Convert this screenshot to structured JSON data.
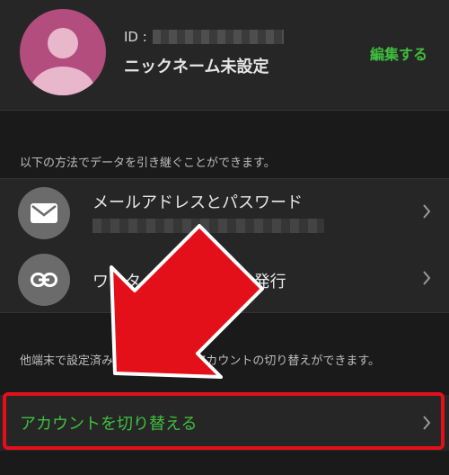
{
  "profile": {
    "id_label": "ID :",
    "nickname": "ニックネーム未設定",
    "edit_label": "編集する"
  },
  "transfer": {
    "description": "以下の方法でデータを引き継ぐことができます。",
    "methods": [
      {
        "label": "メールアドレスとパスワード",
        "icon": "mail-icon"
      },
      {
        "label": "ワンタイムパスワード発行",
        "icon": "link-icon"
      }
    ]
  },
  "switch": {
    "description": "他端末で設定済みの方法を使ってアカウントの切り替えができます。",
    "label": "アカウントを切り替える"
  },
  "colors": {
    "accent_green": "#3fbf3f",
    "highlight_red": "#e3101a",
    "avatar_pink": "#b24d7d"
  }
}
